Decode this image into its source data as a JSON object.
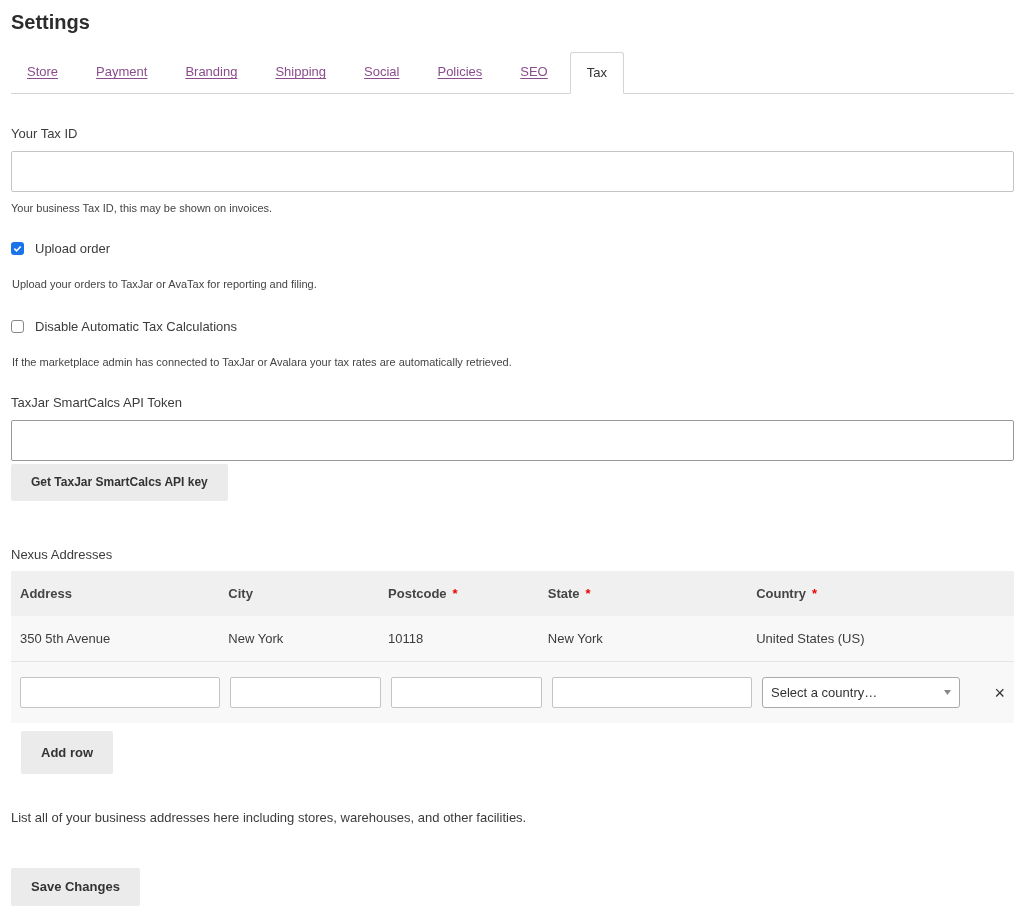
{
  "title": "Settings",
  "tabs": [
    {
      "label": "Store",
      "selected": false
    },
    {
      "label": "Payment",
      "selected": false
    },
    {
      "label": "Branding",
      "selected": false
    },
    {
      "label": "Shipping",
      "selected": false
    },
    {
      "label": "Social",
      "selected": false
    },
    {
      "label": "Policies",
      "selected": false
    },
    {
      "label": "SEO",
      "selected": false
    },
    {
      "label": "Tax",
      "selected": true
    }
  ],
  "tax_id": {
    "label": "Your Tax ID",
    "help": "Your business Tax ID, this may be shown on invoices."
  },
  "options": [
    {
      "label": "Upload order",
      "checked": true,
      "help": "Upload your orders to TaxJar or AvaTax for reporting and filing."
    },
    {
      "label": "Disable Automatic Tax Calculations",
      "checked": false,
      "help": "If the marketplace admin has connected to TaxJar or Avalara your tax rates are automatically retrieved."
    }
  ],
  "api_token": {
    "label": "TaxJar SmartCalcs API Token",
    "button": "Get TaxJar SmartCalcs API key"
  },
  "nexus": {
    "label": "Nexus Addresses",
    "columns": [
      {
        "label": "Address"
      },
      {
        "label": "City"
      },
      {
        "label": "Postcode",
        "mark": "*"
      },
      {
        "label": "State",
        "mark": "*"
      },
      {
        "label": "Country",
        "mark": "*"
      }
    ],
    "rows": [
      [
        "350 5th Avenue",
        "New York",
        "10118",
        "New York",
        "United States (US)"
      ]
    ],
    "country_placeholder": "Select a country…",
    "remove": "×",
    "add_button": "Add row",
    "help": "List all of your business addresses here including stores, warehouses, and other facilities."
  },
  "save_button": "Save Changes"
}
